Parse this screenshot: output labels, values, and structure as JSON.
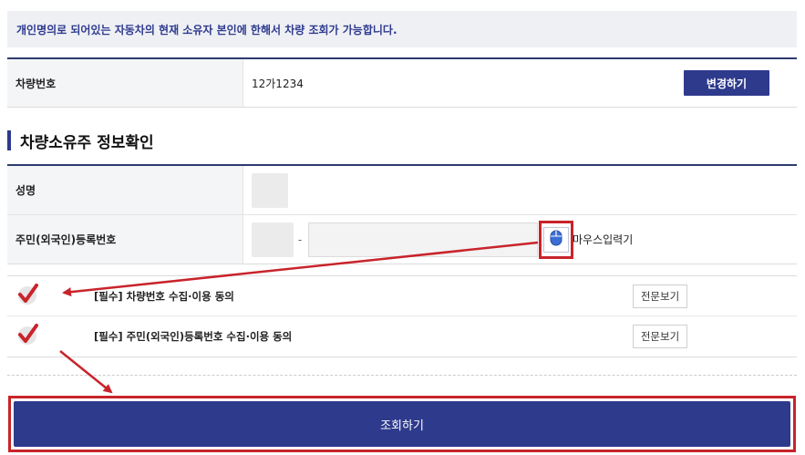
{
  "notice": {
    "text": "개인명의로 되어있는 자동차의 현재 소유자 본인에 한해서 차량 조회가 가능합니다."
  },
  "vehicle": {
    "label": "차량번호",
    "value": "12가1234",
    "change_button": "변경하기"
  },
  "owner_section": {
    "title": "차량소유주 정보확인",
    "name_label": "성명",
    "rrn_label": "주민(외국인)등록번호",
    "rrn_dash": "-",
    "mouse_input_label": "마우스입력기"
  },
  "agreements": [
    {
      "label": "[필수] 차량번호 수집·이용 동의",
      "button": "전문보기",
      "checked": true
    },
    {
      "label": "[필수] 주민(외국인)등록번호 수집·이용 동의",
      "button": "전문보기",
      "checked": true
    }
  ],
  "submit": {
    "label": "조회하기"
  },
  "colors": {
    "primary": "#2e3a8c",
    "highlight": "#c8242b",
    "check": "#c8242b"
  },
  "icons": {
    "mouse_input": "mouse-icon",
    "check": "checkmark-icon"
  }
}
